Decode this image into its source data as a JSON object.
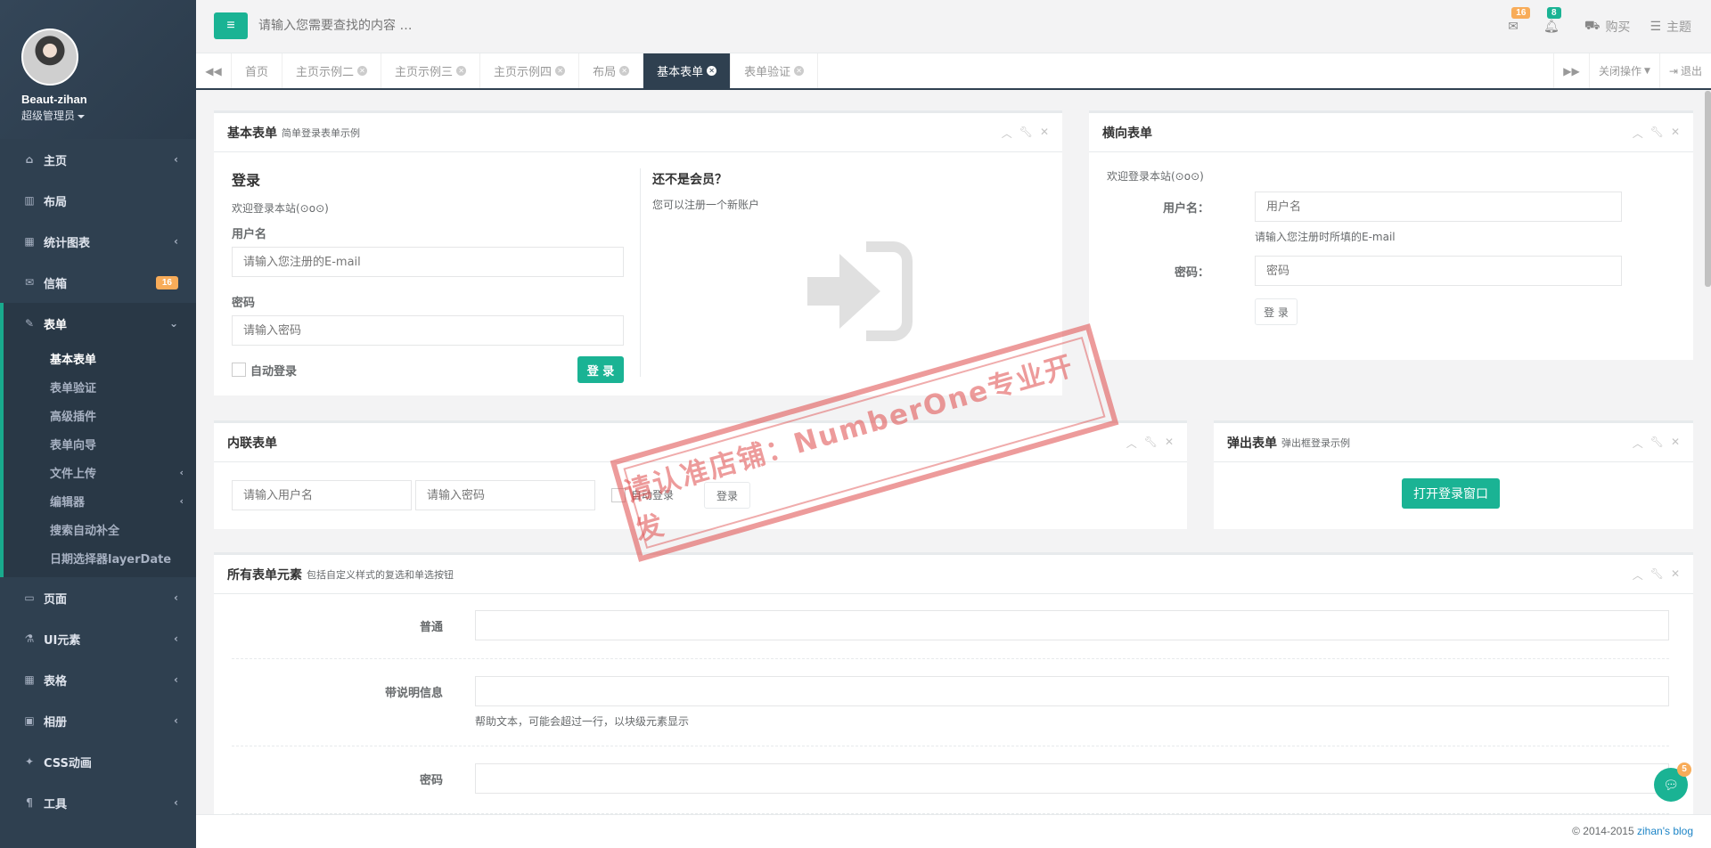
{
  "profile": {
    "name": "Beaut-zihan",
    "role": "超级管理员"
  },
  "sidebar": {
    "items": [
      {
        "label": "主页",
        "icon": "home-icon",
        "glyph": "⌂",
        "chev": "‹"
      },
      {
        "label": "布局",
        "icon": "columns-icon",
        "glyph": "▥",
        "chev": ""
      },
      {
        "label": "统计图表",
        "icon": "bar-chart-icon",
        "glyph": "▦",
        "chev": "‹"
      },
      {
        "label": "信箱",
        "icon": "envelope-icon",
        "glyph": "✉",
        "badge": "16"
      },
      {
        "label": "表单",
        "icon": "edit-icon",
        "glyph": "✎",
        "chev": "⌄"
      },
      {
        "label": "页面",
        "icon": "desktop-icon",
        "glyph": "▭",
        "chev": "‹"
      },
      {
        "label": "UI元素",
        "icon": "flask-icon",
        "glyph": "⚗",
        "chev": "‹"
      },
      {
        "label": "表格",
        "icon": "table-icon",
        "glyph": "▦",
        "chev": "‹"
      },
      {
        "label": "相册",
        "icon": "picture-icon",
        "glyph": "▣",
        "chev": "‹"
      },
      {
        "label": "CSS动画",
        "icon": "magic-icon",
        "glyph": "✦",
        "chev": ""
      },
      {
        "label": "工具",
        "icon": "cutlery-icon",
        "glyph": "¶",
        "chev": "‹"
      }
    ],
    "submenu": [
      {
        "label": "基本表单",
        "chev": ""
      },
      {
        "label": "表单验证",
        "chev": ""
      },
      {
        "label": "高级插件",
        "chev": ""
      },
      {
        "label": "表单向导",
        "chev": ""
      },
      {
        "label": "文件上传",
        "chev": "‹"
      },
      {
        "label": "编辑器",
        "chev": "‹"
      },
      {
        "label": "搜索自动补全",
        "chev": ""
      },
      {
        "label": "日期选择器layerDate",
        "chev": ""
      }
    ]
  },
  "topbar": {
    "search_placeholder": "请输入您需要查找的内容 …",
    "mail_badge": "16",
    "bell_badge": "8",
    "buy_label": "购买",
    "theme_label": "主题"
  },
  "tabs": [
    "首页",
    "主页示例二",
    "主页示例三",
    "主页示例四",
    "布局",
    "基本表单",
    "表单验证"
  ],
  "tab_tools": {
    "close_ops": "关闭操作",
    "logout": "退出"
  },
  "basic_form": {
    "title": "基本表单",
    "subtitle": "简单登录表单示例",
    "login_heading": "登录",
    "welcome": "欢迎登录本站(⊙o⊙)",
    "username_label": "用户名",
    "username_placeholder": "请输入您注册的E-mail",
    "password_label": "密码",
    "password_placeholder": "请输入密码",
    "remember": "自动登录",
    "submit": "登 录",
    "not_member": "还不是会员？",
    "register_text": "您可以注册一个新账户"
  },
  "horizontal_form": {
    "title": "横向表单",
    "welcome": "欢迎登录本站(⊙o⊙)",
    "username_label": "用户名：",
    "username_placeholder": "用户名",
    "help": "请输入您注册时所填的E-mail",
    "password_label": "密码：",
    "password_placeholder": "密码",
    "submit": "登 录"
  },
  "inline_form": {
    "title": "内联表单",
    "username_placeholder": "请输入用户名",
    "password_placeholder": "请输入密码",
    "remember": "自动登录",
    "submit": "登录"
  },
  "modal_form": {
    "title": "弹出表单",
    "subtitle": "弹出框登录示例",
    "button": "打开登录窗口"
  },
  "all_elements": {
    "title": "所有表单元素",
    "subtitle": "包括自定义样式的复选和单选按钮",
    "normal_label": "普通",
    "help_label": "带说明信息",
    "help_text": "帮助文本，可能会超过一行，以块级元素显示",
    "password_label": "密码"
  },
  "watermark": "请认准店铺：NumberOne专业开发",
  "footer": {
    "copyright": "© 2014-2015 ",
    "link": "zihan's blog"
  },
  "chat_badge": "5",
  "colors": {
    "primary": "#1ab394",
    "sidebar": "#2f4050",
    "warning": "#f8ac59",
    "link": "#1c84c6"
  }
}
